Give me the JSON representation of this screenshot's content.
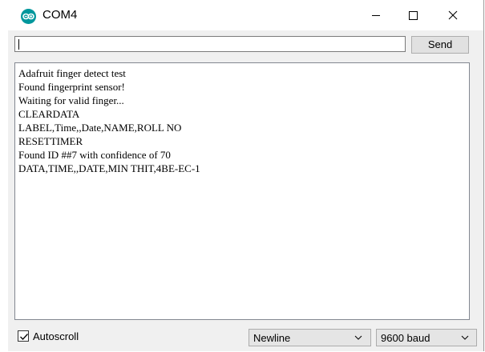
{
  "window": {
    "title": "COM4",
    "controls": {
      "minimize_icon": "minimize-icon",
      "maximize_icon": "maximize-icon",
      "close_icon": "close-icon"
    }
  },
  "toolbar": {
    "input_value": "",
    "send_label": "Send"
  },
  "output": {
    "lines": [
      "Adafruit finger detect test",
      "Found fingerprint sensor!",
      "Waiting for valid finger...",
      "CLEARDATA",
      "LABEL,Time,,Date,NAME,ROLL NO",
      "RESETTIMER",
      "Found ID ##7 with confidence of 70",
      "DATA,TIME,,DATE,MIN THIT,4BE-EC-1"
    ]
  },
  "statusbar": {
    "autoscroll_label": "Autoscroll",
    "autoscroll_checked": true,
    "line_ending": "Newline",
    "baud_rate": "9600 baud"
  },
  "colors": {
    "logo": "#00979c",
    "window_bg": "#f0f0f0",
    "output_bg": "#ffffff"
  }
}
